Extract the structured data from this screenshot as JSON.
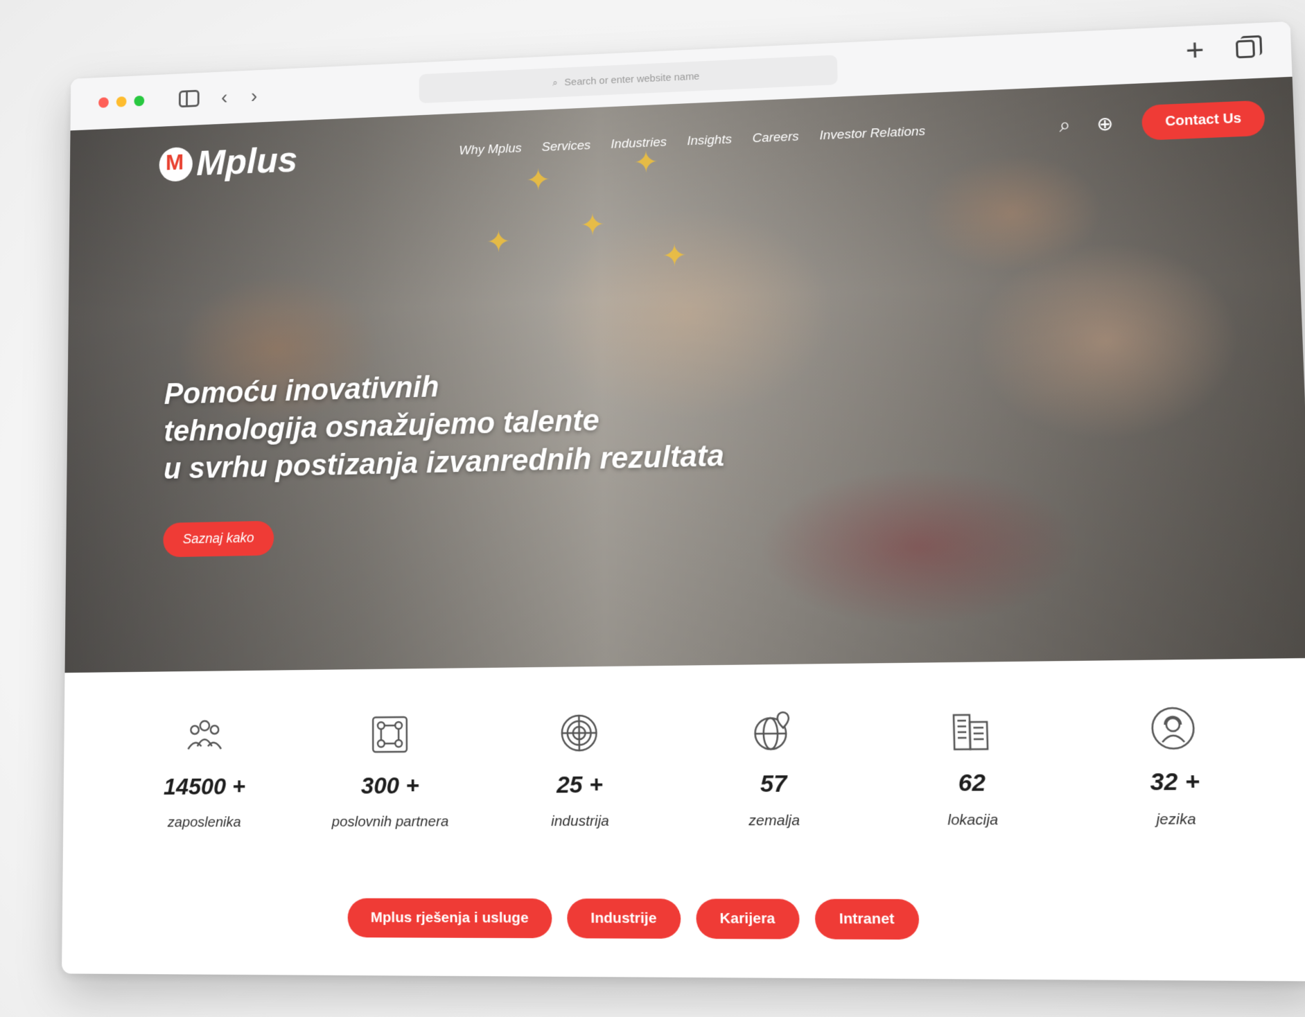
{
  "browser": {
    "address_placeholder": "Search or enter website name",
    "icons": [
      "sidebar-toggle-icon",
      "back-icon",
      "forward-icon",
      "new-tab-icon",
      "tabs-icon"
    ]
  },
  "site": {
    "logo_text": "Mplus",
    "nav": [
      "Why Mplus",
      "Services",
      "Industries",
      "Insights",
      "Careers",
      "Investor Relations"
    ],
    "contact_label": "Contact Us",
    "headline": [
      "Pomoću inovativnih",
      "tehnologija osnažujemo talente",
      "u svrhu postizanja izvanrednih rezultata"
    ],
    "cta_label": "Saznaj kako"
  },
  "stats": [
    {
      "value": "14500 +",
      "label": "zaposlenika",
      "icon": "people-icon"
    },
    {
      "value": "300 +",
      "label": "poslovnih partnera",
      "icon": "network-icon"
    },
    {
      "value": "25 +",
      "label": "industrija",
      "icon": "fingerprint-globe-icon"
    },
    {
      "value": "57",
      "label": "zemalja",
      "icon": "globe-pin-icon"
    },
    {
      "value": "62",
      "label": "lokacija",
      "icon": "building-icon"
    },
    {
      "value": "32 +",
      "label": "jezika",
      "icon": "headset-agent-icon"
    }
  ],
  "links": [
    "Mplus rješenja i usluge",
    "Industrije",
    "Karijera",
    "Intranet"
  ],
  "colors": {
    "accent": "#ef3b36"
  }
}
